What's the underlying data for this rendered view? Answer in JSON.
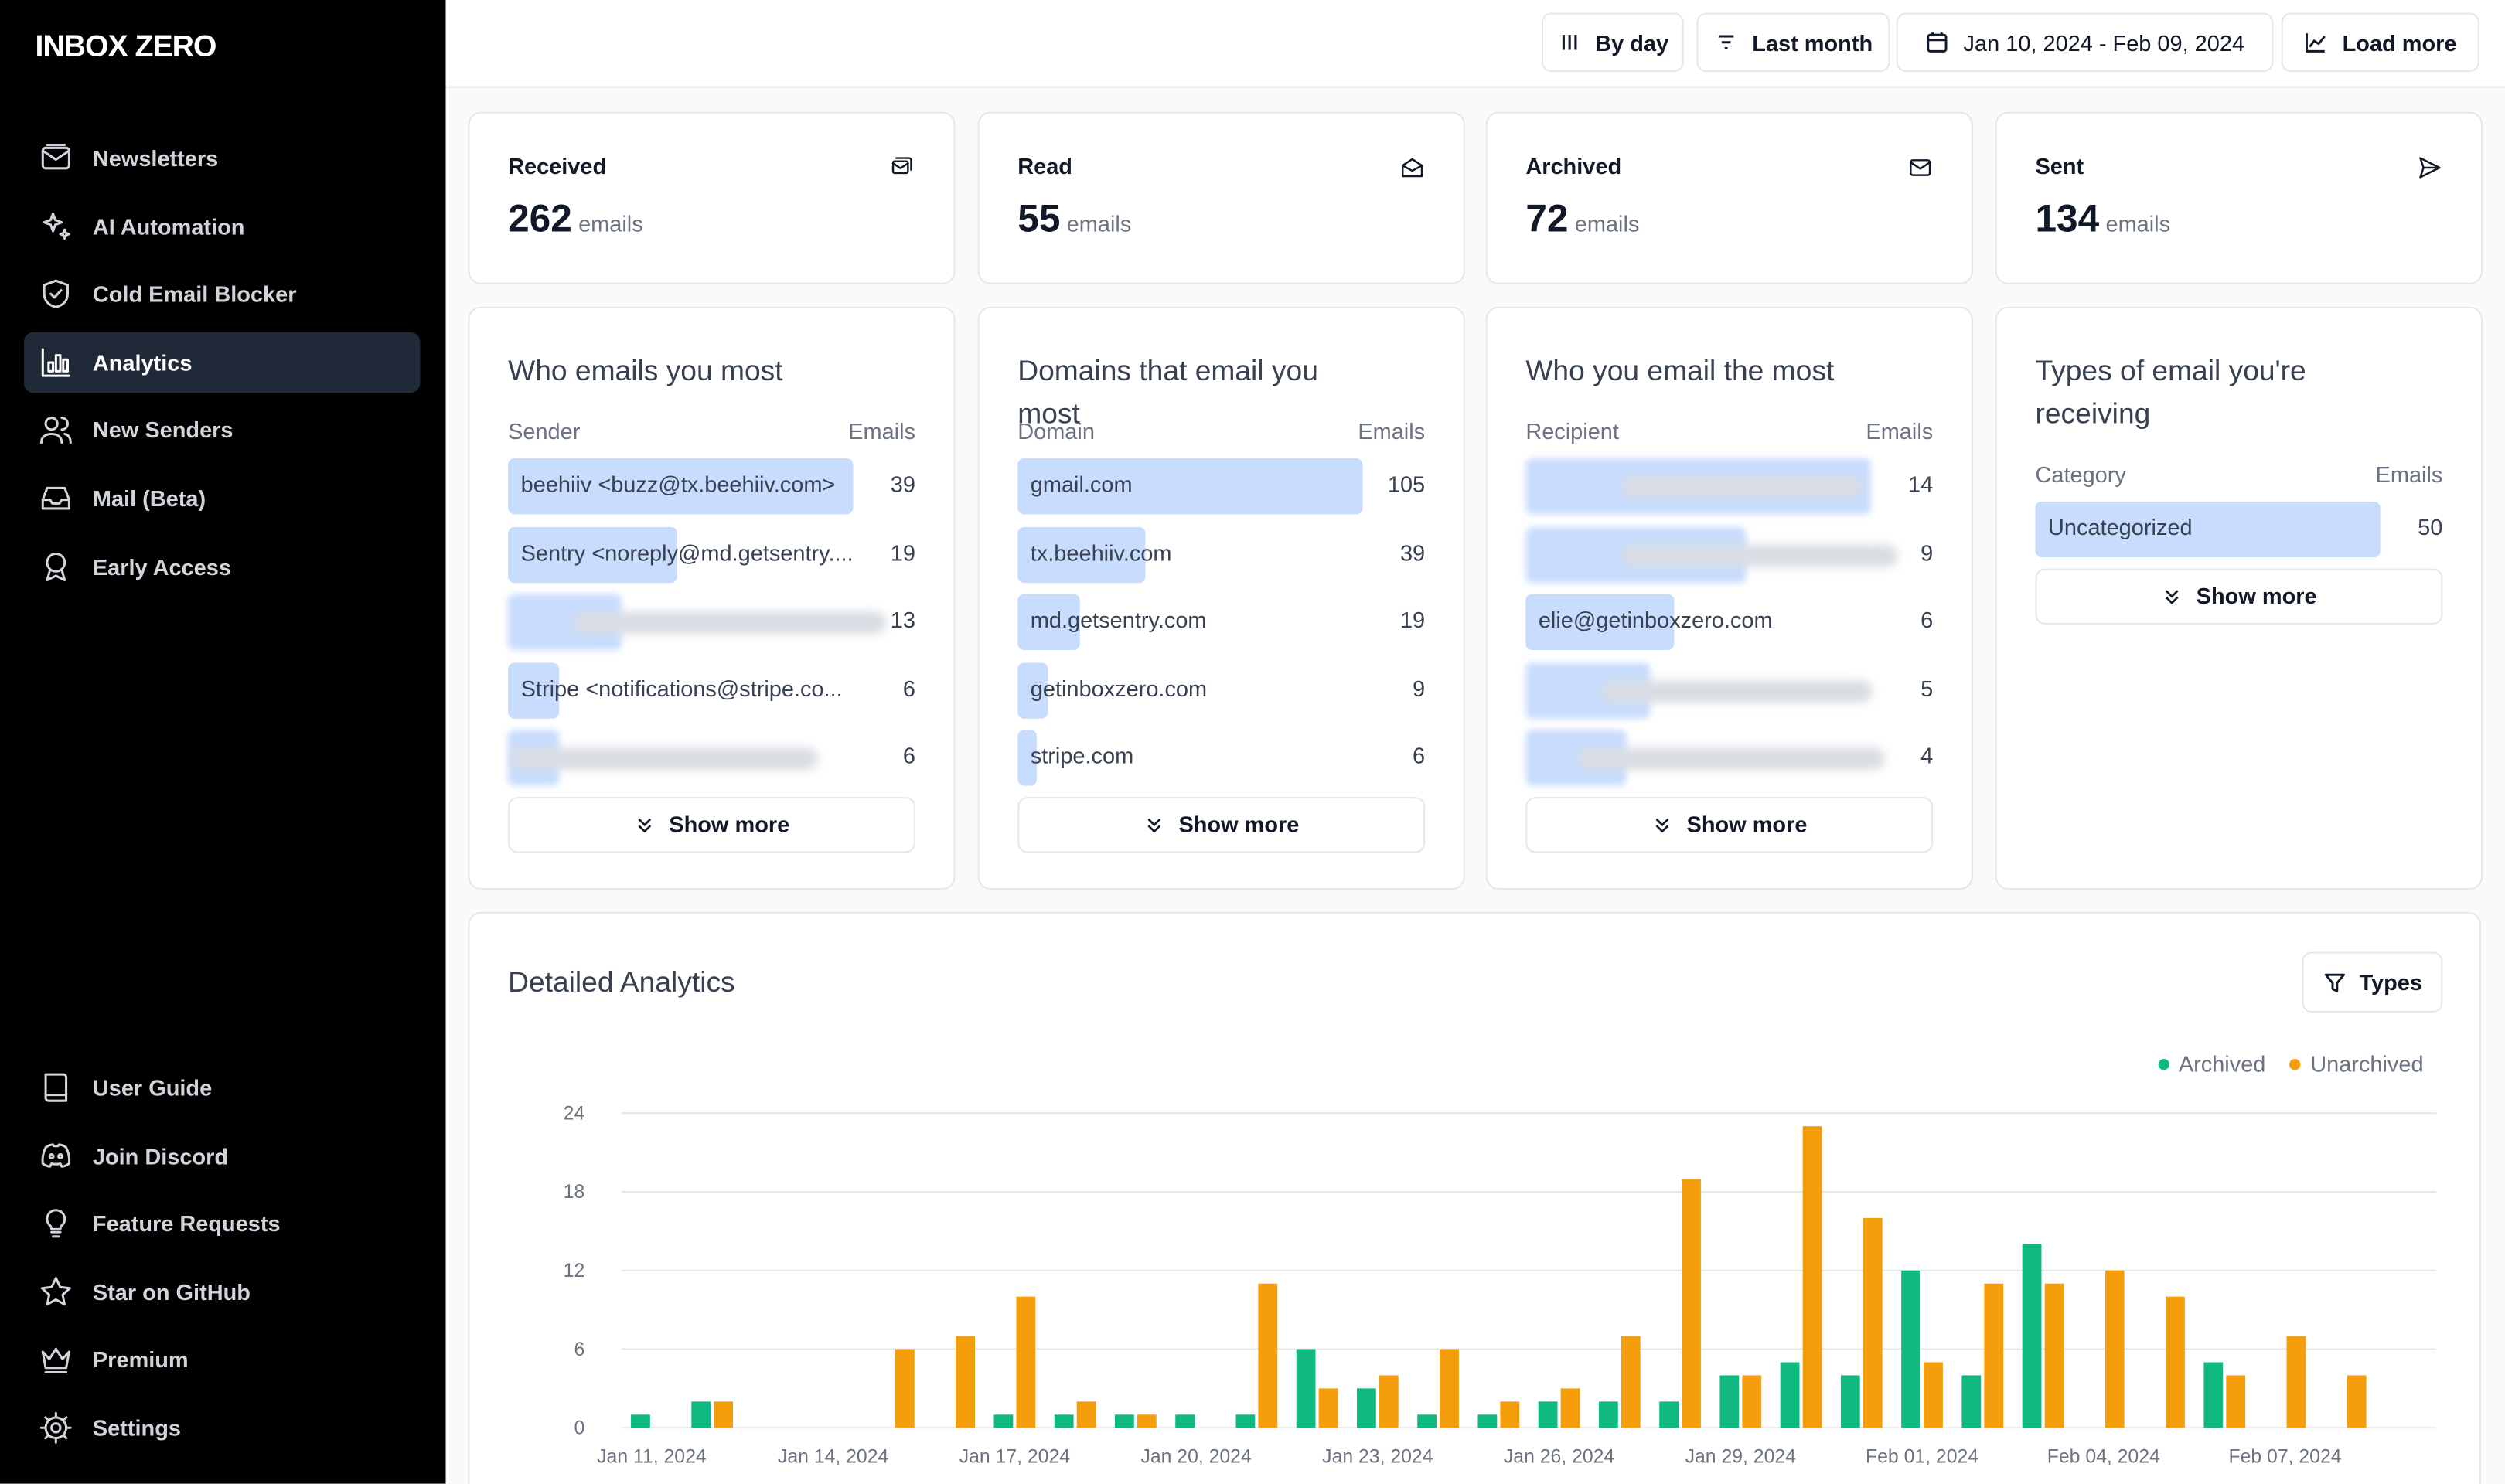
{
  "app": {
    "logo": "INBOX ZERO"
  },
  "sidebar": {
    "top": [
      {
        "label": "Newsletters",
        "icon": "newsletter-icon"
      },
      {
        "label": "AI Automation",
        "icon": "sparkles-icon"
      },
      {
        "label": "Cold Email Blocker",
        "icon": "shield-icon"
      },
      {
        "label": "Analytics",
        "icon": "bar-chart-icon",
        "active": true
      },
      {
        "label": "New Senders",
        "icon": "users-icon"
      },
      {
        "label": "Mail (Beta)",
        "icon": "inbox-icon"
      },
      {
        "label": "Early Access",
        "icon": "ribbon-icon"
      }
    ],
    "bottom": [
      {
        "label": "User Guide",
        "icon": "book-icon"
      },
      {
        "label": "Join Discord",
        "icon": "discord-icon"
      },
      {
        "label": "Feature Requests",
        "icon": "lightbulb-icon"
      },
      {
        "label": "Star on GitHub",
        "icon": "star-icon"
      },
      {
        "label": "Premium",
        "icon": "crown-icon"
      },
      {
        "label": "Settings",
        "icon": "gear-icon"
      }
    ]
  },
  "header": {
    "by_day": "By day",
    "period": "Last month",
    "date_range": "Jan 10, 2024 - Feb 09, 2024",
    "load_more": "Load more"
  },
  "stats": [
    {
      "label": "Received",
      "value": "262",
      "unit": "emails",
      "icon": "mail-stack-icon"
    },
    {
      "label": "Read",
      "value": "55",
      "unit": "emails",
      "icon": "mail-open-icon"
    },
    {
      "label": "Archived",
      "value": "72",
      "unit": "emails",
      "icon": "mail-archive-icon"
    },
    {
      "label": "Sent",
      "value": "134",
      "unit": "emails",
      "icon": "send-icon"
    }
  ],
  "lists": [
    {
      "title": "Who emails you most",
      "col1": "Sender",
      "col2": "Emails",
      "show_more": "Show more",
      "rows": [
        {
          "name": "beehiiv <buzz@tx.beehiiv.com>",
          "value": "39",
          "fill": 1.0
        },
        {
          "name": "Sentry <noreply@md.getsentry....",
          "value": "19",
          "fill": 0.49
        },
        {
          "name": "",
          "value": "13",
          "fill": 0.33,
          "blurred": true
        },
        {
          "name": "Stripe <notifications@stripe.co...",
          "value": "6",
          "fill": 0.15
        },
        {
          "name": "",
          "value": "6",
          "fill": 0.15,
          "blurred": true
        }
      ]
    },
    {
      "title": "Domains that email you most",
      "col1": "Domain",
      "col2": "Emails",
      "show_more": "Show more",
      "rows": [
        {
          "name": "gmail.com",
          "value": "105",
          "fill": 1.0
        },
        {
          "name": "tx.beehiiv.com",
          "value": "39",
          "fill": 0.37
        },
        {
          "name": "md.getsentry.com",
          "value": "19",
          "fill": 0.18
        },
        {
          "name": "getinboxzero.com",
          "value": "9",
          "fill": 0.086
        },
        {
          "name": "stripe.com",
          "value": "6",
          "fill": 0.057
        }
      ]
    },
    {
      "title": "Who you email the most",
      "col1": "Recipient",
      "col2": "Emails",
      "show_more": "Show more",
      "rows": [
        {
          "name": "",
          "value": "14",
          "fill": 1.0,
          "blurred": true
        },
        {
          "name": "",
          "value": "9",
          "fill": 0.64,
          "blurred": true
        },
        {
          "name": "elie@getinboxzero.com",
          "value": "6",
          "fill": 0.43
        },
        {
          "name": "",
          "value": "5",
          "fill": 0.36,
          "blurred": true
        },
        {
          "name": "",
          "value": "4",
          "fill": 0.29,
          "blurred": true
        }
      ]
    },
    {
      "title": "Types of email you're receiving",
      "col1": "Category",
      "col2": "Emails",
      "show_more": "Show more",
      "rows": [
        {
          "name": "Uncategorized",
          "value": "50",
          "fill": 1.0
        }
      ]
    }
  ],
  "detailed": {
    "title": "Detailed Analytics",
    "types_button": "Types"
  },
  "chart_data": {
    "type": "bar",
    "title": "",
    "xlabel": "",
    "ylabel": "",
    "ylim": [
      0,
      24
    ],
    "yticks": [
      0,
      6,
      12,
      18,
      24
    ],
    "grid": true,
    "legend_position": "top-right",
    "x_tick_labels": [
      "Jan 11, 2024",
      "Jan 14, 2024",
      "Jan 17, 2024",
      "Jan 20, 2024",
      "Jan 23, 2024",
      "Jan 26, 2024",
      "Jan 29, 2024",
      "Feb 01, 2024",
      "Feb 04, 2024",
      "Feb 07, 2024"
    ],
    "categories": [
      "Jan 11, 2024",
      "Jan 12, 2024",
      "Jan 13, 2024",
      "Jan 14, 2024",
      "Jan 15, 2024",
      "Jan 16, 2024",
      "Jan 17, 2024",
      "Jan 18, 2024",
      "Jan 19, 2024",
      "Jan 20, 2024",
      "Jan 21, 2024",
      "Jan 22, 2024",
      "Jan 23, 2024",
      "Jan 24, 2024",
      "Jan 25, 2024",
      "Jan 26, 2024",
      "Jan 27, 2024",
      "Jan 28, 2024",
      "Jan 29, 2024",
      "Jan 30, 2024",
      "Jan 31, 2024",
      "Feb 01, 2024",
      "Feb 02, 2024",
      "Feb 03, 2024",
      "Feb 04, 2024",
      "Feb 05, 2024",
      "Feb 06, 2024",
      "Feb 07, 2024",
      "Feb 08, 2024",
      "Feb 09, 2024"
    ],
    "series": [
      {
        "name": "Archived",
        "color": "#10b981",
        "values": [
          1,
          2,
          0,
          0,
          0,
          0,
          1,
          1,
          1,
          1,
          1,
          6,
          3,
          1,
          1,
          2,
          2,
          2,
          4,
          5,
          4,
          12,
          4,
          14,
          0,
          0,
          5,
          0,
          0,
          0
        ]
      },
      {
        "name": "Unarchived",
        "color": "#f59e0b",
        "values": [
          0,
          2,
          0,
          0,
          6,
          7,
          10,
          2,
          1,
          0,
          11,
          3,
          4,
          6,
          2,
          3,
          7,
          19,
          4,
          23,
          16,
          5,
          11,
          11,
          12,
          10,
          4,
          7,
          4,
          0
        ]
      }
    ]
  }
}
